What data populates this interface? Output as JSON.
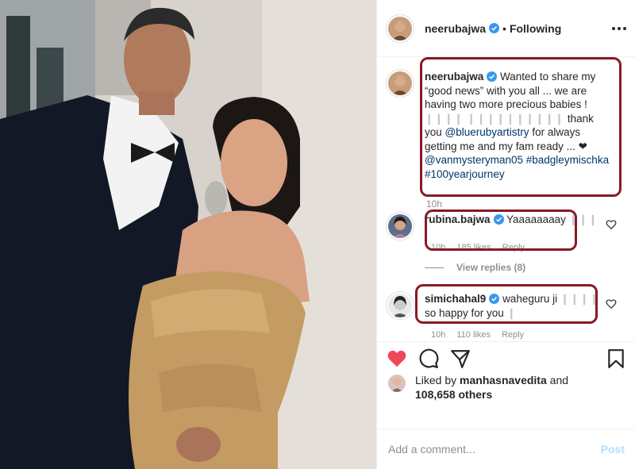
{
  "post": {
    "username": "neerubajwa",
    "follow_state": "Following",
    "separator": "•"
  },
  "caption": {
    "username": "neerubajwa",
    "text_before": "Wanted to share my “good news” with you all ... we are having two more precious babies !",
    "blur1": "❙❙❙❙",
    "blur2": "❙❙❙❙❙❙❙❙❙❙",
    "text_mid": "thank you",
    "mention1": "@bluerubyartistry",
    "text_after": "for always getting me and my fam ready ... ❤",
    "mention2": "@vanmysteryman05",
    "hashtag1": "#badgleymischka",
    "hashtag2": "#100yearjourney",
    "time": "10h"
  },
  "comments": [
    {
      "username": "rubina.bajwa",
      "text": "Yaaaaaaaay",
      "blur": "❙❙❙",
      "time": "10h",
      "likes": "185 likes",
      "reply": "Reply",
      "view_replies": "View replies (8)"
    },
    {
      "username": "simichahal9",
      "text": "waheguru ji",
      "blur": "❙❙❙❙",
      "text2": "so happy for you",
      "blur2": "❙",
      "time": "10h",
      "likes": "110 likes",
      "reply": "Reply"
    }
  ],
  "likes": {
    "prefix": "Liked by",
    "user": "manhasnavedita",
    "and": "and",
    "count": "108,658 others"
  },
  "add_comment": {
    "placeholder": "Add a comment...",
    "post_label": "Post"
  },
  "icons": {
    "like": "heart-filled-icon",
    "comment": "comment-bubble-icon",
    "share": "paper-plane-icon",
    "save": "bookmark-icon",
    "more": "more-dots-icon",
    "verified": "verified-badge-icon"
  },
  "colors": {
    "heart": "#ed4956",
    "link": "#003569",
    "verified": "#3897f0",
    "annotation": "#8a1a24",
    "post_button": "#b2dffc"
  }
}
